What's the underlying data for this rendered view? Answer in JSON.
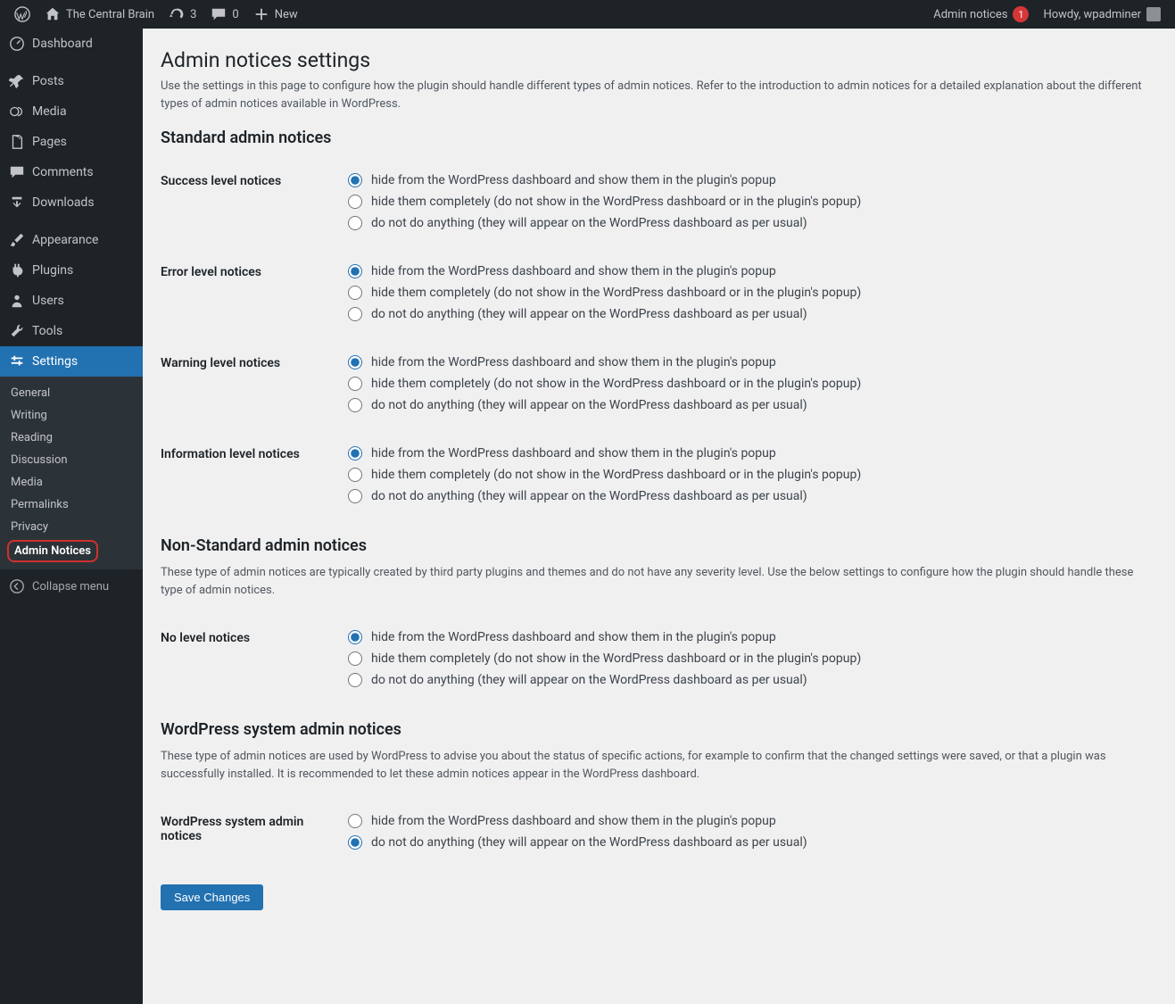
{
  "adminBar": {
    "siteName": "The Central Brain",
    "updatesCount": "3",
    "commentsCount": "0",
    "newLabel": "New",
    "noticesLabel": "Admin notices",
    "noticesCount": "1",
    "howdy": "Howdy, wpadminer"
  },
  "sidebar": {
    "dashboard": "Dashboard",
    "posts": "Posts",
    "media": "Media",
    "pages": "Pages",
    "comments": "Comments",
    "downloads": "Downloads",
    "appearance": "Appearance",
    "plugins": "Plugins",
    "users": "Users",
    "tools": "Tools",
    "settings": "Settings",
    "collapse": "Collapse menu"
  },
  "submenu": {
    "general": "General",
    "writing": "Writing",
    "reading": "Reading",
    "discussion": "Discussion",
    "media": "Media",
    "permalinks": "Permalinks",
    "privacy": "Privacy",
    "adminNotices": "Admin Notices"
  },
  "page": {
    "title": "Admin notices settings",
    "intro": "Use the settings in this page to configure how the plugin should handle different types of admin notices. Refer to the introduction to admin notices for a detailed explanation about the different types of admin notices available in WordPress.",
    "h2Standard": "Standard admin notices",
    "h2NonStandard": "Non-Standard admin notices",
    "nonStandardDesc": "These type of admin notices are typically created by third party plugins and themes and do not have any severity level. Use the below settings to configure how the plugin should handle these type of admin notices.",
    "h2System": "WordPress system admin notices",
    "systemDesc": "These type of admin notices are used by WordPress to advise you about the status of specific actions, for example to confirm that the changed settings were saved, or that a plugin was successfully installed. It is recommended to let these admin notices appear in the WordPress dashboard.",
    "saveBtn": "Save Changes"
  },
  "labels": {
    "success": "Success level notices",
    "error": "Error level notices",
    "warning": "Warning level notices",
    "info": "Information level notices",
    "noLevel": "No level notices",
    "system": "WordPress system admin notices"
  },
  "opts": {
    "hide": "hide from the WordPress dashboard and show them in the plugin's popup",
    "hideAll": "hide them completely (do not show in the WordPress dashboard or in the plugin's popup)",
    "doNothing": "do not do anything (they will appear on the WordPress dashboard as per usual)"
  }
}
